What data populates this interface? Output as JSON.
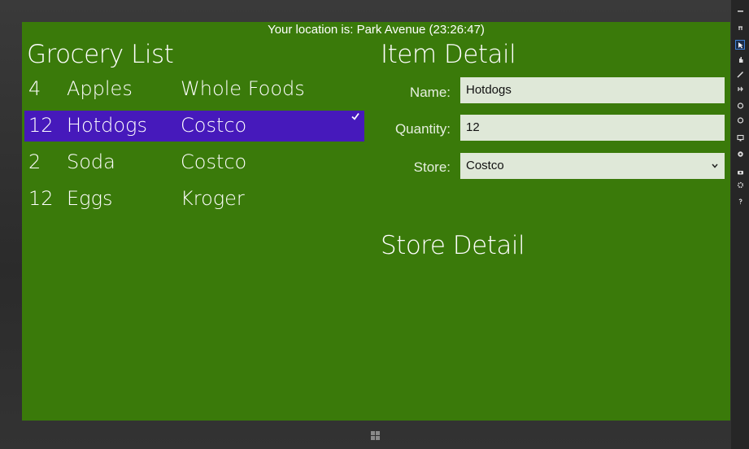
{
  "header": {
    "location": "Your location is: Park Avenue (23:26:47)"
  },
  "grocery": {
    "title": "Grocery List",
    "items": [
      {
        "qty": "4",
        "name": "Apples",
        "store": "Whole Foods",
        "selected": false
      },
      {
        "qty": "12",
        "name": "Hotdogs",
        "store": "Costco",
        "selected": true
      },
      {
        "qty": "2",
        "name": "Soda",
        "store": "Costco",
        "selected": false
      },
      {
        "qty": "12",
        "name": "Eggs",
        "store": "Kroger",
        "selected": false
      }
    ]
  },
  "item_detail": {
    "title": "Item Detail",
    "name_label": "Name:",
    "name_value": "Hotdogs",
    "quantity_label": "Quantity:",
    "quantity_value": "12",
    "store_label": "Store:",
    "store_value": "Costco"
  },
  "store_detail": {
    "title": "Store Detail"
  },
  "colors": {
    "background": "#3a7a0a",
    "selection": "#4619bb",
    "field": "#dfe8d8"
  },
  "charms": [
    "minimize-icon",
    "pin-icon",
    "pointer-icon",
    "hand-icon",
    "pen-icon",
    "zoom-icon",
    "rotate-left-icon",
    "rotate-right-icon",
    "monitor-icon",
    "settings-icon",
    "camera-icon",
    "gear-icon",
    "help-icon"
  ]
}
